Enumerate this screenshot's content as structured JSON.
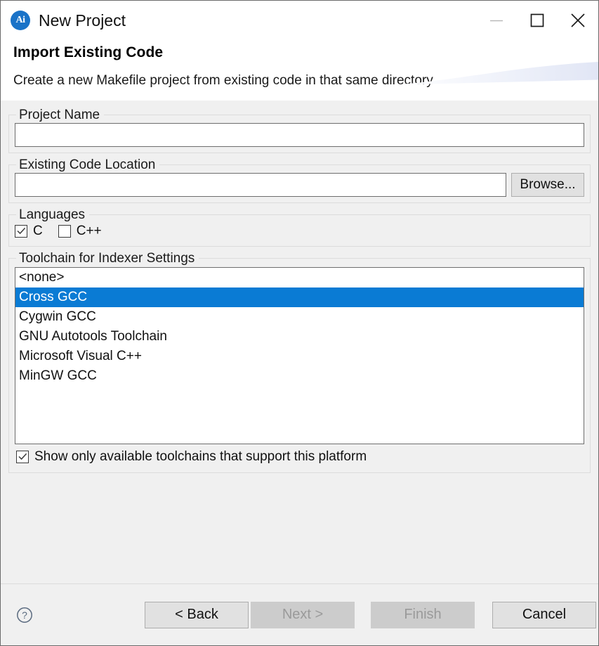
{
  "window": {
    "title": "New Project",
    "app_icon": "Ai",
    "controls": {
      "minimize": "minimize-icon",
      "maximize": "maximize-icon",
      "close": "close-icon"
    }
  },
  "header": {
    "title": "Import Existing Code",
    "description": "Create a new Makefile project from existing code in that same directory"
  },
  "project_name": {
    "legend": "Project Name",
    "value": "",
    "placeholder": ""
  },
  "existing_code_location": {
    "legend": "Existing Code Location",
    "value": "",
    "placeholder": "",
    "browse_label": "Browse..."
  },
  "languages": {
    "legend": "Languages",
    "options": [
      {
        "label": "C",
        "checked": true
      },
      {
        "label": "C++",
        "checked": false
      }
    ]
  },
  "toolchain": {
    "legend": "Toolchain for Indexer Settings",
    "items": [
      {
        "label": "<none>",
        "selected": false
      },
      {
        "label": "Cross GCC",
        "selected": true
      },
      {
        "label": "Cygwin GCC",
        "selected": false
      },
      {
        "label": "GNU Autotools Toolchain",
        "selected": false
      },
      {
        "label": "Microsoft Visual C++",
        "selected": false
      },
      {
        "label": "MinGW GCC",
        "selected": false
      }
    ],
    "selected_value": "Cross GCC",
    "show_only": {
      "label": "Show only available toolchains that support this platform",
      "checked": true
    }
  },
  "footer": {
    "help_icon": "help-circle-icon",
    "buttons": [
      {
        "label": "< Back",
        "enabled": true
      },
      {
        "label": "Next >",
        "enabled": false
      },
      {
        "label": "Finish",
        "enabled": false
      },
      {
        "label": "Cancel",
        "enabled": true
      }
    ]
  },
  "colors": {
    "selection_blue": "#0a7bd4",
    "icon_blue": "#1a73c8",
    "panel_gray": "#f0f0f0",
    "disabled_text": "#9a9a9a"
  }
}
